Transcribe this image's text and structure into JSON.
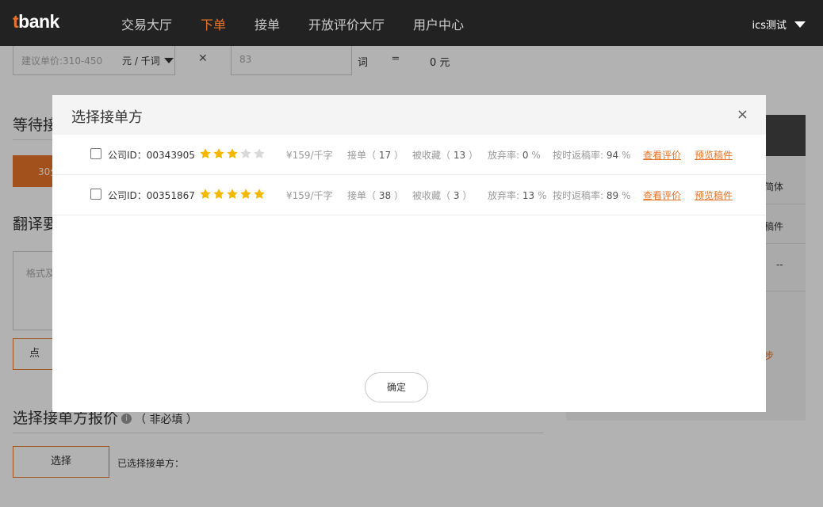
{
  "nav": {
    "logo_t": "t",
    "logo_rest": "bank",
    "items": [
      {
        "label": "交易大厅"
      },
      {
        "label": "下单"
      },
      {
        "label": "接单"
      },
      {
        "label": "开放评价大厅"
      },
      {
        "label": "用户中心"
      }
    ],
    "user": "ics测试"
  },
  "background": {
    "price_placeholder": "建议单价:310-450",
    "unit_select": "元 / 千词",
    "multiply": "✕",
    "word_count_placeholder": "83",
    "word_unit": "词",
    "equals": "═",
    "total": "0 元",
    "waiting_title": "等待接",
    "orange_btn": "30分",
    "translate_title": "翻译要",
    "format_placeholder": "格式及",
    "click_btn": "点",
    "select_quote_title": "选择接单方报价",
    "optional": "（ 非必填 ）",
    "select_btn": "选择",
    "selected_label": "已选择接单方：",
    "side": {
      "simplified": "简体",
      "draft": "稿件",
      "dash": "--",
      "step": "步"
    }
  },
  "modal": {
    "title": "选择接单方",
    "close": "×",
    "confirm": "确定",
    "rows": [
      {
        "company": "公司ID：00343905",
        "rating": 3,
        "price": "¥159/千字",
        "orders_label": "接单（",
        "orders": "17",
        "orders_end": "）",
        "fav_label": "被收藏（",
        "fav": "13",
        "fav_end": "）",
        "abandon_label": "放弃率:",
        "abandon": "0",
        "abandon_unit": "%",
        "ontime_label": "按时返稿率:",
        "ontime": "94",
        "ontime_unit": "%",
        "review_link": "查看评价",
        "preview_link": "预览稿件"
      },
      {
        "company": "公司ID：00351867",
        "rating": 5,
        "price": "¥159/千字",
        "orders_label": "接单（",
        "orders": "38",
        "orders_end": "）",
        "fav_label": "被收藏（",
        "fav": "3",
        "fav_end": "）",
        "abandon_label": "放弃率:",
        "abandon": "13",
        "abandon_unit": "%",
        "ontime_label": "按时返稿率:",
        "ontime": "89",
        "ontime_unit": "%",
        "review_link": "查看评价",
        "preview_link": "预览稿件"
      }
    ]
  },
  "colors": {
    "accent": "#e8742a",
    "star_on": "#f5b800",
    "star_off": "#d9d9d9",
    "topbar": "#222222"
  }
}
